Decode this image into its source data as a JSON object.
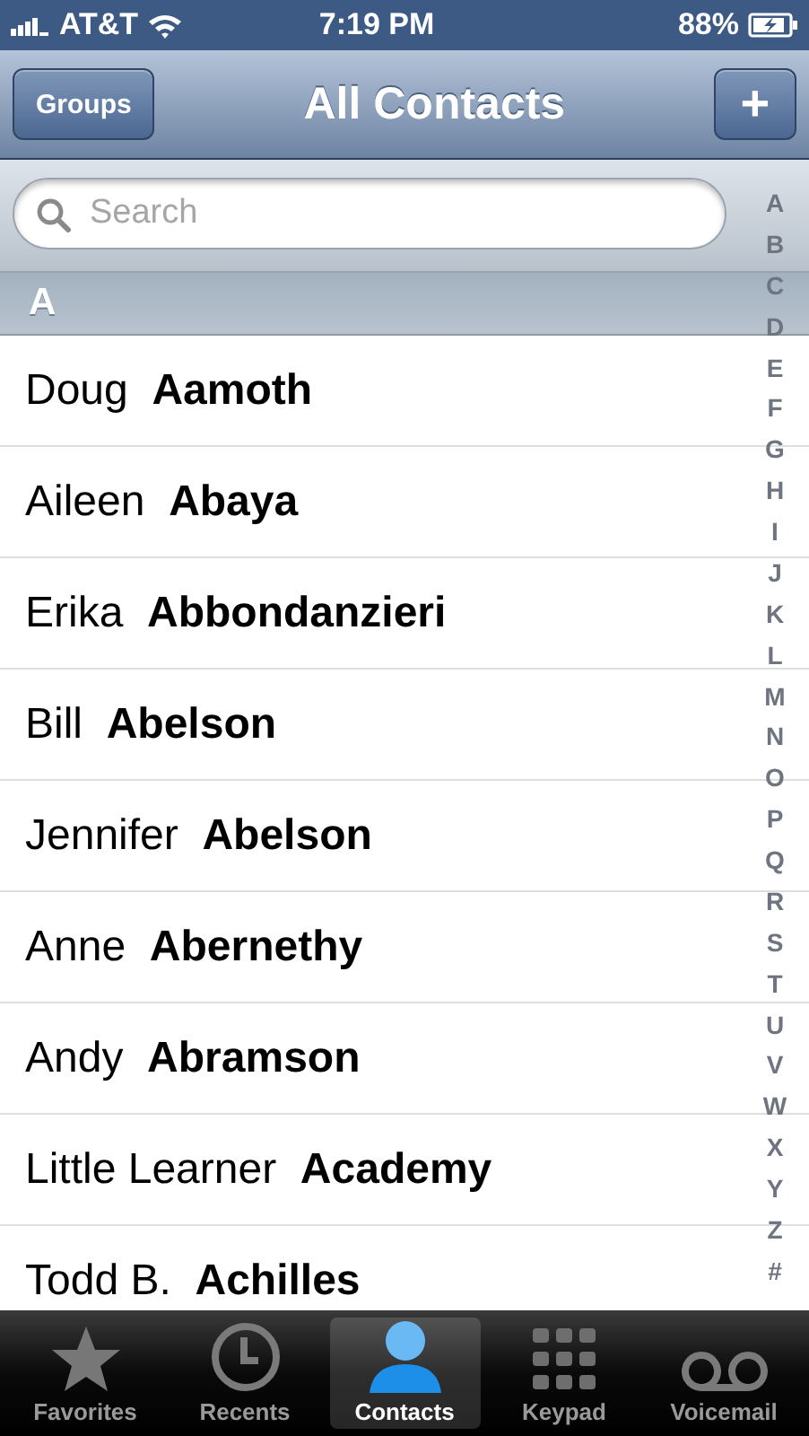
{
  "status_bar": {
    "carrier": "AT&T",
    "time": "7:19 PM",
    "battery": "88%"
  },
  "nav": {
    "left_button": "Groups",
    "title": "All Contacts",
    "right_button": "+"
  },
  "search": {
    "placeholder": "Search"
  },
  "section": {
    "header": "A"
  },
  "contacts": [
    {
      "first": "Doug",
      "last": "Aamoth"
    },
    {
      "first": "Aileen",
      "last": "Abaya"
    },
    {
      "first": "Erika",
      "last": "Abbondanzieri"
    },
    {
      "first": "Bill",
      "last": "Abelson"
    },
    {
      "first": "Jennifer",
      "last": "Abelson"
    },
    {
      "first": "Anne",
      "last": "Abernethy"
    },
    {
      "first": "Andy",
      "last": "Abramson"
    },
    {
      "first": "Little Learner",
      "last": "Academy"
    },
    {
      "first": "Todd B.",
      "last": "Achilles"
    }
  ],
  "index": [
    "A",
    "B",
    "C",
    "D",
    "E",
    "F",
    "G",
    "H",
    "I",
    "J",
    "K",
    "L",
    "M",
    "N",
    "O",
    "P",
    "Q",
    "R",
    "S",
    "T",
    "U",
    "V",
    "W",
    "X",
    "Y",
    "Z",
    "#"
  ],
  "tabs": [
    {
      "label": "Favorites",
      "selected": false
    },
    {
      "label": "Recents",
      "selected": false
    },
    {
      "label": "Contacts",
      "selected": true
    },
    {
      "label": "Keypad",
      "selected": false
    },
    {
      "label": "Voicemail",
      "selected": false
    }
  ]
}
